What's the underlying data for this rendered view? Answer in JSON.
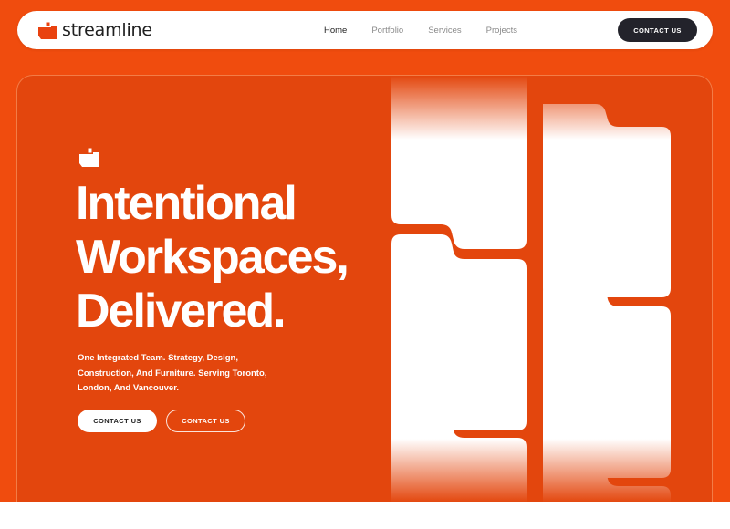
{
  "brand": {
    "name": "streamline",
    "primary_color": "#f04c0e",
    "hero_color": "#e3460d",
    "dark_color": "#23232b",
    "logo_icon": "streamline-logo-icon"
  },
  "nav": {
    "links": [
      "Home",
      "Portfolio",
      "Services",
      "Projects"
    ],
    "active": "Home",
    "cta_label": "CONTACT US"
  },
  "hero": {
    "icon": "streamline-mark-icon",
    "title_lines": [
      "Intentional",
      "Workspaces,",
      "Delivered."
    ],
    "subtitle": "One Integrated Team. Strategy, Design, Construction, And Furniture. Serving Toronto, London, And Vancouver.",
    "primary_button": "CONTACT US",
    "secondary_button": "CONTACT US"
  }
}
